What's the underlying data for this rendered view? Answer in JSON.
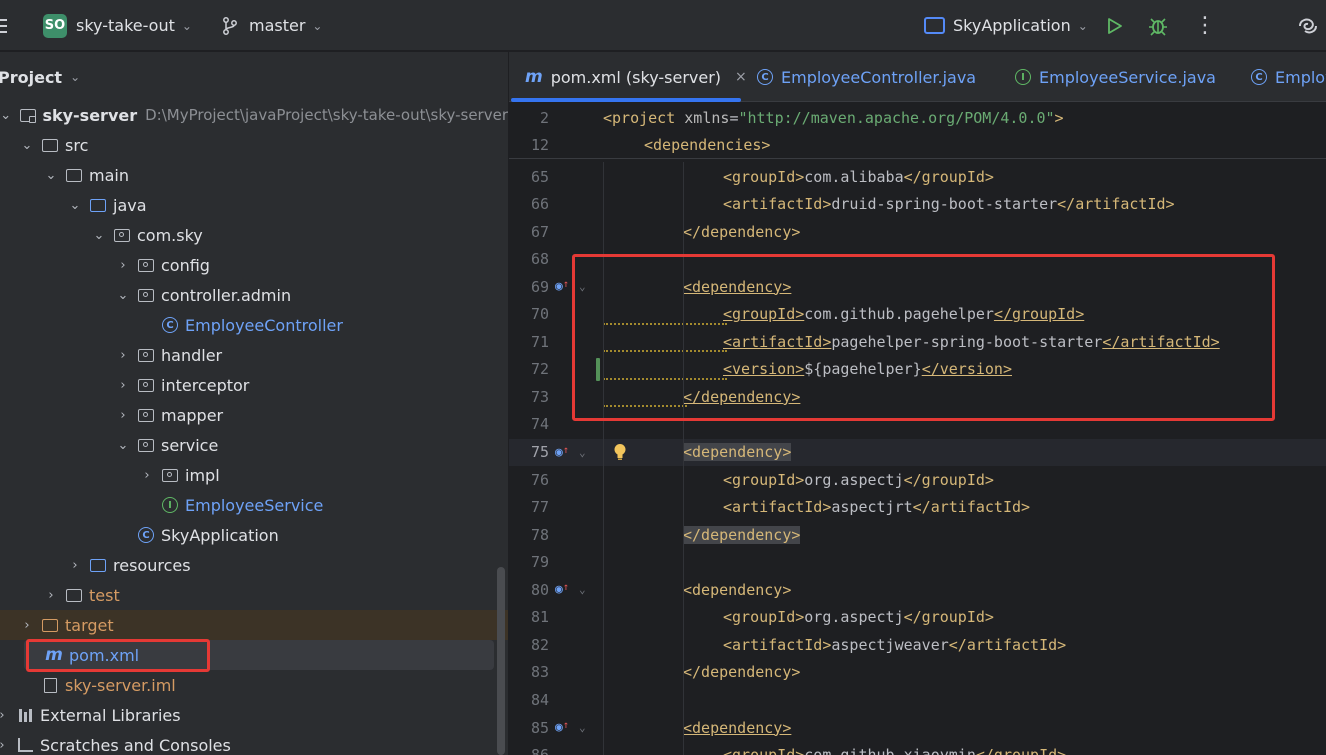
{
  "topbar": {
    "project_badge": "SO",
    "project_name": "sky-take-out",
    "branch": "master",
    "run_config": "SkyApplication"
  },
  "panel": {
    "title": "Project",
    "tree": [
      {
        "label": "sky-server",
        "path": "D:\\MyProject\\javaProject\\sky-take-out\\sky-server"
      },
      {
        "label": "src"
      },
      {
        "label": "main"
      },
      {
        "label": "java"
      },
      {
        "label": "com.sky"
      },
      {
        "label": "config"
      },
      {
        "label": "controller.admin"
      },
      {
        "label": "EmployeeController"
      },
      {
        "label": "handler"
      },
      {
        "label": "interceptor"
      },
      {
        "label": "mapper"
      },
      {
        "label": "service"
      },
      {
        "label": "impl"
      },
      {
        "label": "EmployeeService"
      },
      {
        "label": "SkyApplication"
      },
      {
        "label": "resources"
      },
      {
        "label": "test"
      },
      {
        "label": "target"
      },
      {
        "label": "pom.xml"
      },
      {
        "label": "sky-server.iml"
      },
      {
        "label": "External Libraries"
      },
      {
        "label": "Scratches and Consoles"
      }
    ]
  },
  "tabs": [
    {
      "label": "pom.xml (sky-server)",
      "close": "×"
    },
    {
      "label": "EmployeeController.java"
    },
    {
      "label": "EmployeeService.java"
    },
    {
      "label": "Employ"
    }
  ],
  "editor": {
    "sticky": [
      {
        "ln": "2",
        "parts": [
          "<project ",
          "xmlns",
          "=",
          "\"http://maven.apache.org/POM/4.0.0\""
        ]
      },
      {
        "ln": "12",
        "parts": [
          "<dependencies>"
        ]
      }
    ],
    "lines": [
      {
        "ln": "65",
        "indent": 3,
        "open": "<groupId>",
        "text": "com.alibaba",
        "close": "</groupId>"
      },
      {
        "ln": "66",
        "indent": 3,
        "open": "<artifactId>",
        "text": "druid-spring-boot-starter",
        "close": "</artifactId>"
      },
      {
        "ln": "67",
        "indent": 2,
        "open": "</dependency>"
      },
      {
        "ln": "68"
      },
      {
        "ln": "69",
        "indent": 2,
        "open": "<dependency>"
      },
      {
        "ln": "70",
        "indent": 3,
        "open": "<groupId>",
        "text": "com.github.pagehelper",
        "close": "</groupId>"
      },
      {
        "ln": "71",
        "indent": 3,
        "open": "<artifactId>",
        "text": "pagehelper-spring-boot-starter",
        "close": "</artifactId>"
      },
      {
        "ln": "72",
        "indent": 3,
        "open": "<version>",
        "text": "${pagehelper}",
        "close": "</version>"
      },
      {
        "ln": "73",
        "indent": 2,
        "open": "</dependency>"
      },
      {
        "ln": "74"
      },
      {
        "ln": "75",
        "indent": 2,
        "open": "<dependency>"
      },
      {
        "ln": "76",
        "indent": 3,
        "open": "<groupId>",
        "text": "org.aspectj",
        "close": "</groupId>"
      },
      {
        "ln": "77",
        "indent": 3,
        "open": "<artifactId>",
        "text": "aspectjrt",
        "close": "</artifactId>"
      },
      {
        "ln": "78",
        "indent": 2,
        "open": "</dependency>"
      },
      {
        "ln": "79"
      },
      {
        "ln": "80",
        "indent": 2,
        "open": "<dependency>"
      },
      {
        "ln": "81",
        "indent": 3,
        "open": "<groupId>",
        "text": "org.aspectj",
        "close": "</groupId>"
      },
      {
        "ln": "82",
        "indent": 3,
        "open": "<artifactId>",
        "text": "aspectjweaver",
        "close": "</artifactId>"
      },
      {
        "ln": "83",
        "indent": 2,
        "open": "</dependency>"
      },
      {
        "ln": "84"
      },
      {
        "ln": "85",
        "indent": 2,
        "open": "<dependency>"
      },
      {
        "ln": "86",
        "indent": 3,
        "open": "<groupId>",
        "text": "com.github.xiaoymin",
        "close": "</groupId>"
      }
    ]
  }
}
